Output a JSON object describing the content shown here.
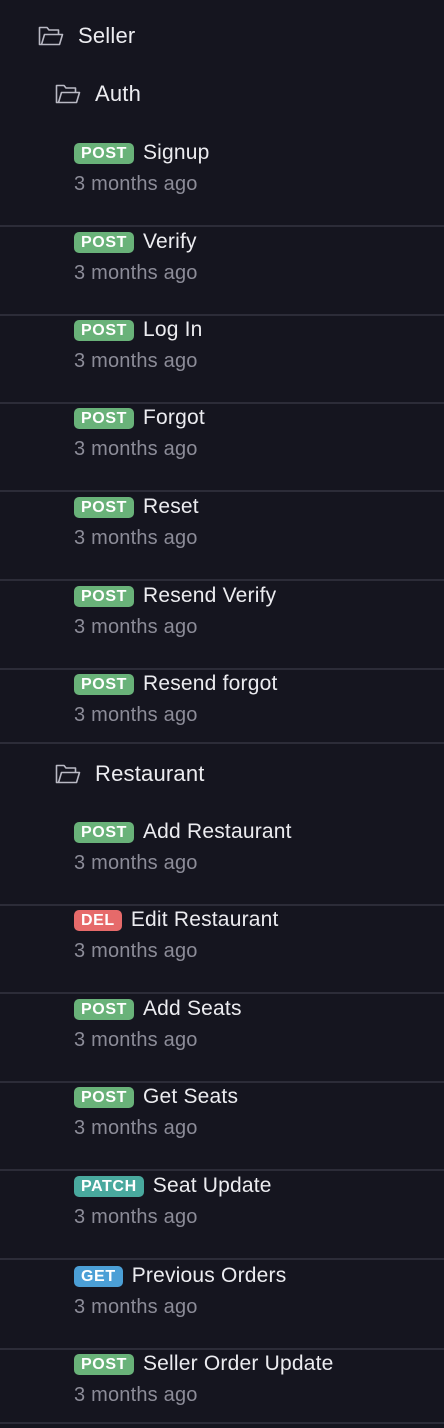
{
  "colors": {
    "background": "#15151f",
    "divider": "#2c2c38",
    "text": "#ececf0",
    "muted": "#8c8c98",
    "POST": "#69b279",
    "DEL": "#e66a6a",
    "PATCH": "#49a99e",
    "GET": "#4b9fd6"
  },
  "tree": {
    "root": {
      "label": "Seller",
      "icon": "folder-open-icon"
    },
    "folders": [
      {
        "label": "Auth",
        "icon": "folder-open-icon",
        "requests": [
          {
            "method": "POST",
            "name": "Signup",
            "time": "3 months ago"
          },
          {
            "method": "POST",
            "name": "Verify",
            "time": "3 months ago"
          },
          {
            "method": "POST",
            "name": "Log In",
            "time": "3 months ago"
          },
          {
            "method": "POST",
            "name": "Forgot",
            "time": "3 months ago"
          },
          {
            "method": "POST",
            "name": "Reset",
            "time": "3 months ago"
          },
          {
            "method": "POST",
            "name": "Resend Verify",
            "time": "3 months ago"
          },
          {
            "method": "POST",
            "name": "Resend forgot",
            "time": "3 months ago"
          }
        ]
      },
      {
        "label": "Restaurant",
        "icon": "folder-open-icon",
        "requests": [
          {
            "method": "POST",
            "name": "Add Restaurant",
            "time": "3 months ago"
          },
          {
            "method": "DEL",
            "name": "Edit Restaurant",
            "time": "3 months ago"
          },
          {
            "method": "POST",
            "name": "Add Seats",
            "time": "3 months ago"
          },
          {
            "method": "POST",
            "name": "Get Seats",
            "time": "3 months ago"
          },
          {
            "method": "PATCH",
            "name": "Seat Update",
            "time": "3 months ago"
          },
          {
            "method": "GET",
            "name": "Previous Orders",
            "time": "3 months ago"
          },
          {
            "method": "POST",
            "name": "Seller Order Update",
            "time": "3 months ago"
          }
        ]
      }
    ]
  }
}
